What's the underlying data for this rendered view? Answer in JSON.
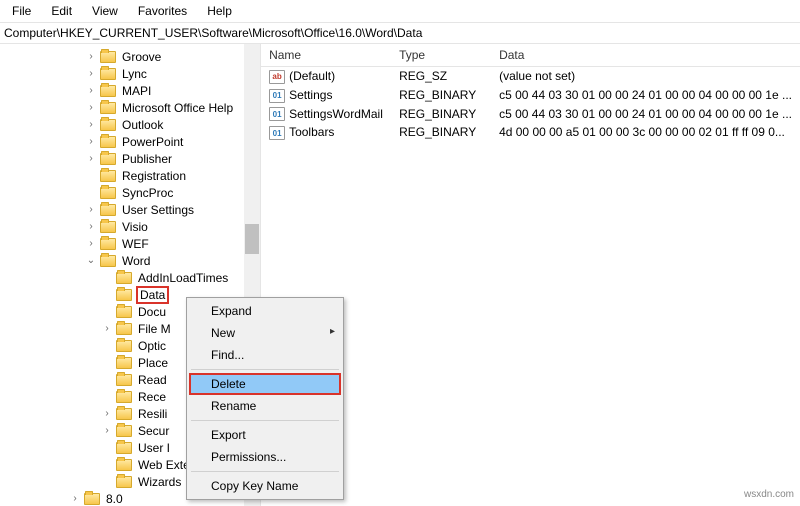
{
  "menu": {
    "file": "File",
    "edit": "Edit",
    "view": "View",
    "favorites": "Favorites",
    "help": "Help"
  },
  "address": "Computer\\HKEY_CURRENT_USER\\Software\\Microsoft\\Office\\16.0\\Word\\Data",
  "tree": [
    {
      "label": "Groove",
      "depth": 5,
      "expand": true
    },
    {
      "label": "Lync",
      "depth": 5,
      "expand": true
    },
    {
      "label": "MAPI",
      "depth": 5,
      "expand": true
    },
    {
      "label": "Microsoft Office Help",
      "depth": 5,
      "expand": true
    },
    {
      "label": "Outlook",
      "depth": 5,
      "expand": true
    },
    {
      "label": "PowerPoint",
      "depth": 5,
      "expand": true
    },
    {
      "label": "Publisher",
      "depth": 5,
      "expand": true
    },
    {
      "label": "Registration",
      "depth": 5,
      "expand": false
    },
    {
      "label": "SyncProc",
      "depth": 5,
      "expand": false
    },
    {
      "label": "User Settings",
      "depth": 5,
      "expand": true
    },
    {
      "label": "Visio",
      "depth": 5,
      "expand": true
    },
    {
      "label": "WEF",
      "depth": 5,
      "expand": true
    },
    {
      "label": "Word",
      "depth": 5,
      "expand": true,
      "open": true
    },
    {
      "label": "AddInLoadTimes",
      "depth": 6,
      "expand": false
    },
    {
      "label": "Data",
      "depth": 6,
      "expand": false,
      "selected": true
    },
    {
      "label": "Docu",
      "depth": 6,
      "expand": false
    },
    {
      "label": "File M",
      "depth": 6,
      "expand": true
    },
    {
      "label": "Optic",
      "depth": 6,
      "expand": false
    },
    {
      "label": "Place",
      "depth": 6,
      "expand": false
    },
    {
      "label": "Read",
      "depth": 6,
      "expand": false
    },
    {
      "label": "Rece",
      "depth": 6,
      "expand": false
    },
    {
      "label": "Resili",
      "depth": 6,
      "expand": true
    },
    {
      "label": "Secur",
      "depth": 6,
      "expand": true
    },
    {
      "label": "User I",
      "depth": 6,
      "expand": false
    },
    {
      "label": "Web Extension List",
      "depth": 6,
      "expand": false
    },
    {
      "label": "Wizards",
      "depth": 6,
      "expand": false
    },
    {
      "label": "8.0",
      "depth": 4,
      "expand": true
    }
  ],
  "list": {
    "headers": {
      "name": "Name",
      "type": "Type",
      "data": "Data"
    },
    "rows": [
      {
        "icon": "str",
        "name": "(Default)",
        "type": "REG_SZ",
        "data": "(value not set)"
      },
      {
        "icon": "bin",
        "name": "Settings",
        "type": "REG_BINARY",
        "data": "c5 00 44 03 30 01 00 00 24 01 00 00 04 00 00 00 1e ..."
      },
      {
        "icon": "bin",
        "name": "SettingsWordMail",
        "type": "REG_BINARY",
        "data": "c5 00 44 03 30 01 00 00 24 01 00 00 04 00 00 00 1e ..."
      },
      {
        "icon": "bin",
        "name": "Toolbars",
        "type": "REG_BINARY",
        "data": "4d 00 00 00 a5 01 00 00 3c 00 00 00 02 01 ff ff 09 0..."
      }
    ]
  },
  "ctx": {
    "expand": "Expand",
    "new": "New",
    "find": "Find...",
    "delete": "Delete",
    "rename": "Rename",
    "export": "Export",
    "permissions": "Permissions...",
    "copykey": "Copy Key Name"
  },
  "watermark": "wsxdn.com"
}
